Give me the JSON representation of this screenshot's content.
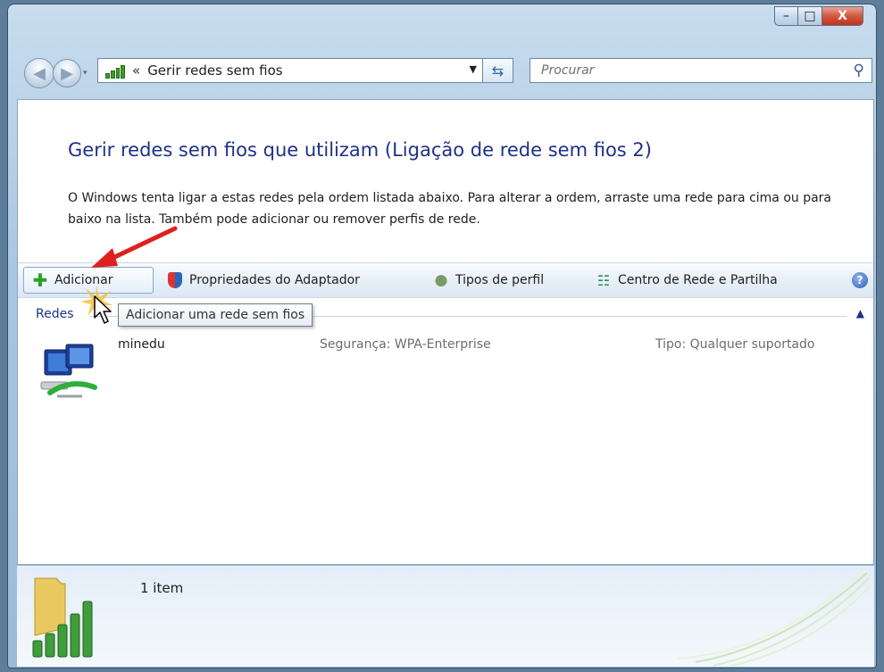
{
  "window": {
    "caption_buttons": {
      "minimize": "–",
      "maximize": "□",
      "close": "X"
    }
  },
  "nav": {
    "address_chevron": "«",
    "address_text": "Gerir redes sem fios",
    "search_placeholder": "Procurar"
  },
  "main": {
    "title": "Gerir redes sem fios que utilizam (Ligação de rede sem fios 2)",
    "description": "O Windows tenta ligar a estas redes pela ordem listada abaixo. Para alterar a ordem, arraste uma rede para cima ou para baixo na lista. Também pode adicionar ou remover perfis de rede."
  },
  "toolbar": {
    "add_label": "Adicionar",
    "adapter_label": "Propriedades do Adaptador",
    "profile_types_label": "Tipos de perfil",
    "network_center_label": "Centro de Rede e Partilha",
    "help_label": "?"
  },
  "group": {
    "header": "Redes",
    "tooltip": "Adicionar uma rede sem fios"
  },
  "networks": [
    {
      "name": "minedu",
      "security": "Segurança: WPA-Enterprise",
      "type": "Tipo: Qualquer suportado"
    }
  ],
  "details": {
    "count": "1 item"
  },
  "colors": {
    "accent_title": "#1e3287",
    "annotation_arrow": "#e02020"
  }
}
